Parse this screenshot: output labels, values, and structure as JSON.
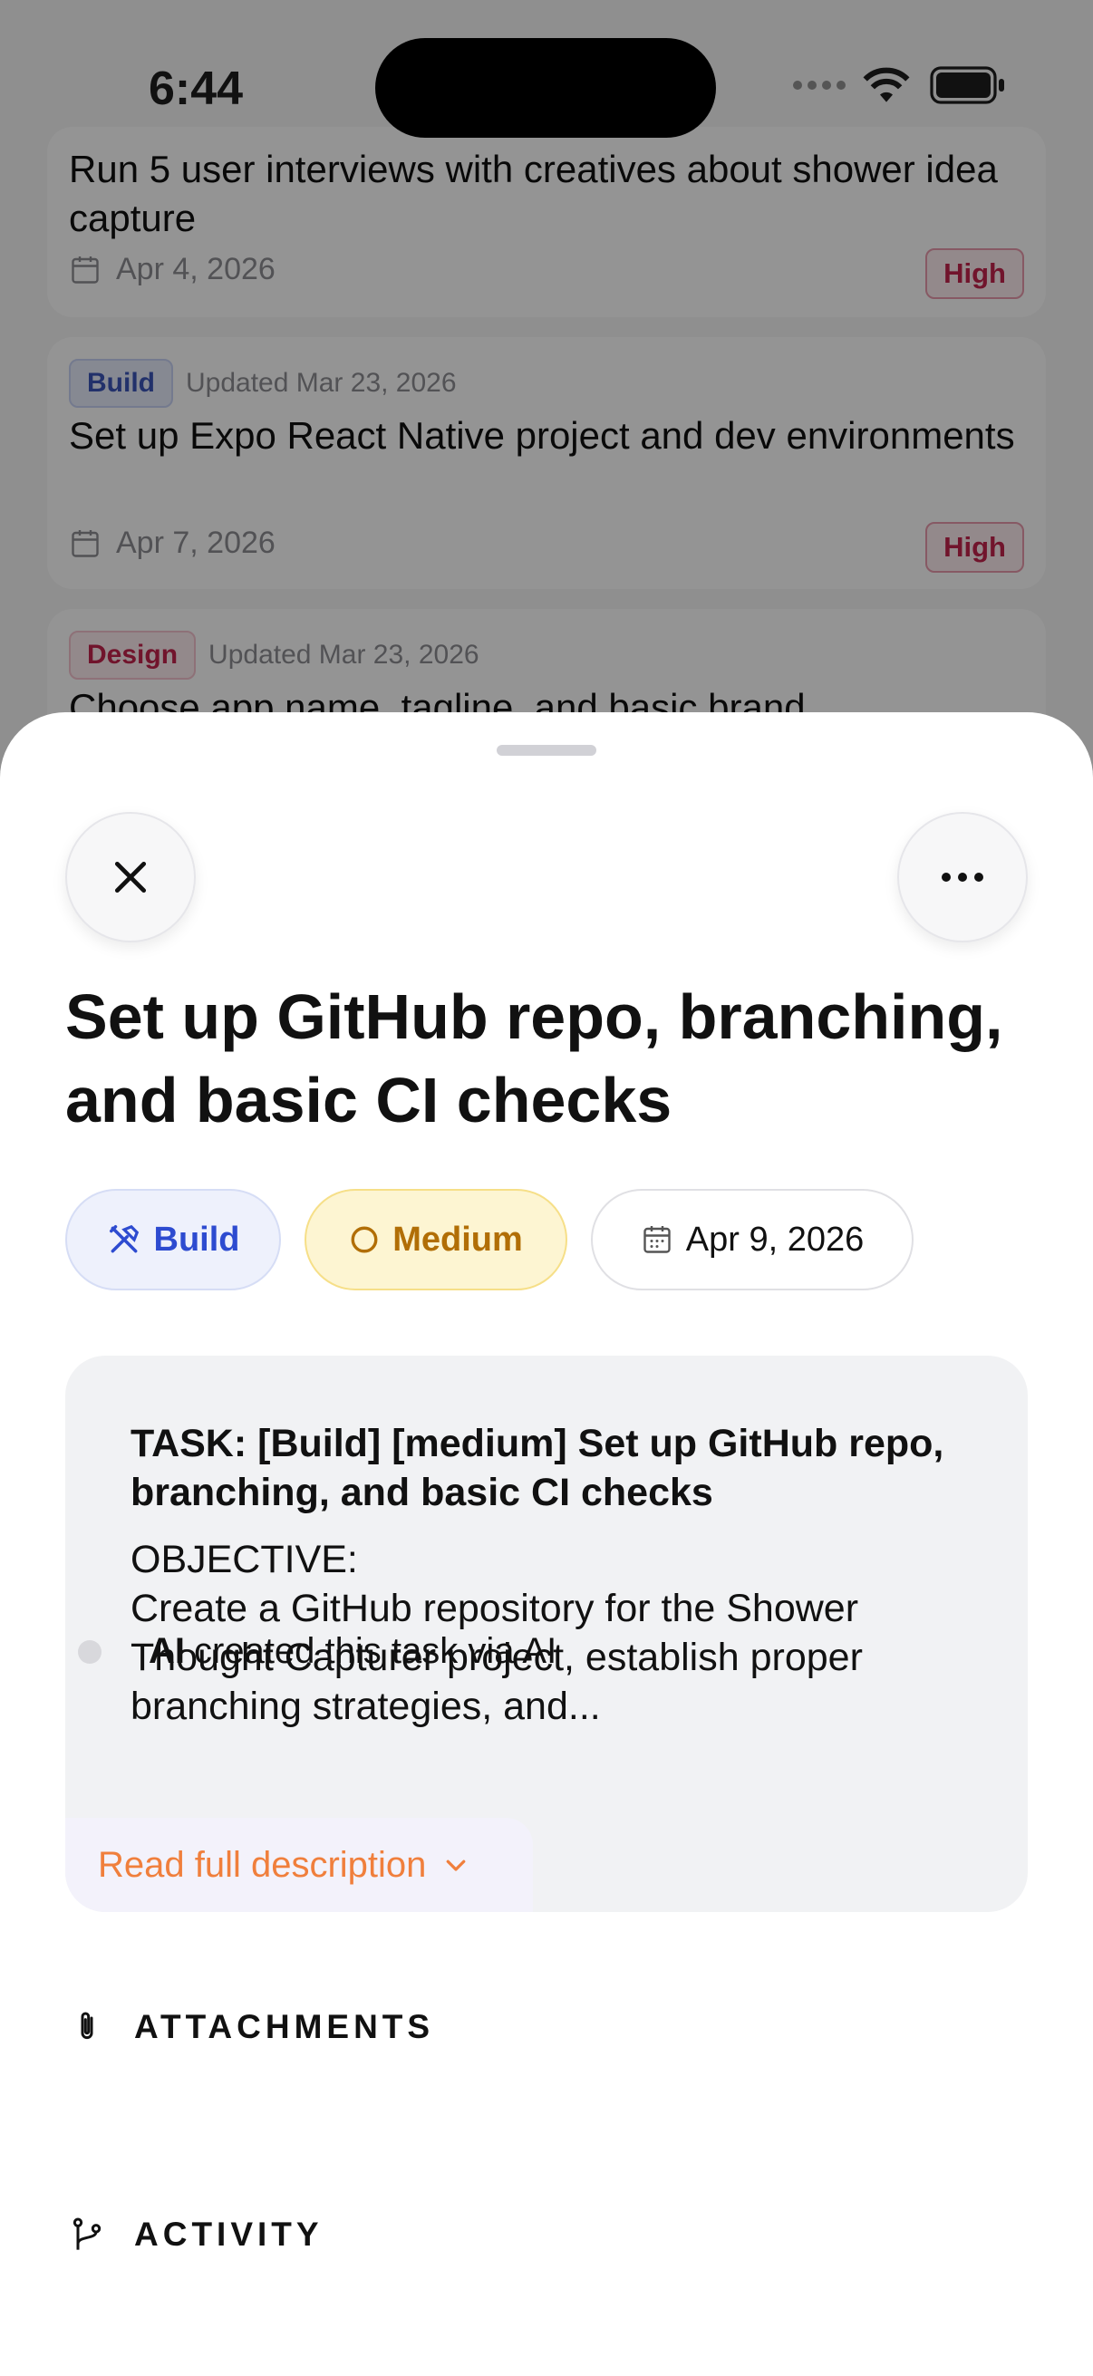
{
  "status_bar": {
    "time": "6:44"
  },
  "background_list": {
    "card1": {
      "title": "Run 5 user interviews with creatives about shower idea capture",
      "date": "Apr 4, 2026",
      "priority": "High"
    },
    "card2": {
      "category": "Build",
      "updated": "Updated Mar 23, 2026",
      "title": "Set up Expo React Native project and dev environments",
      "date": "Apr 7, 2026",
      "priority": "High"
    },
    "card3": {
      "category": "Design",
      "updated": "Updated Mar 23, 2026",
      "title": "Choose app name, tagline, and basic brand"
    }
  },
  "sheet": {
    "title": "Set up GitHub repo, branching, and basic CI checks",
    "chips": {
      "category": "Build",
      "priority": "Medium",
      "due_date": "Apr 9, 2026"
    },
    "description": {
      "heading": "TASK: [Build] [medium] Set up GitHub repo, branching, and basic CI checks",
      "body": "OBJECTIVE:\nCreate a GitHub repository for the Shower Thought Capturer project, establish proper branching strategies, and...",
      "read_more": "Read full description"
    },
    "attachments_label": "ATTACHMENTS",
    "activity_label": "ACTIVITY",
    "activity": [
      {
        "actor": "AI",
        "text": "created this task via AI"
      }
    ]
  },
  "colors": {
    "accent_orange": "#f07f3c",
    "build_blue": "#2d4bd0",
    "medium_amber": "#b16e06",
    "high_red": "#c3244c"
  }
}
